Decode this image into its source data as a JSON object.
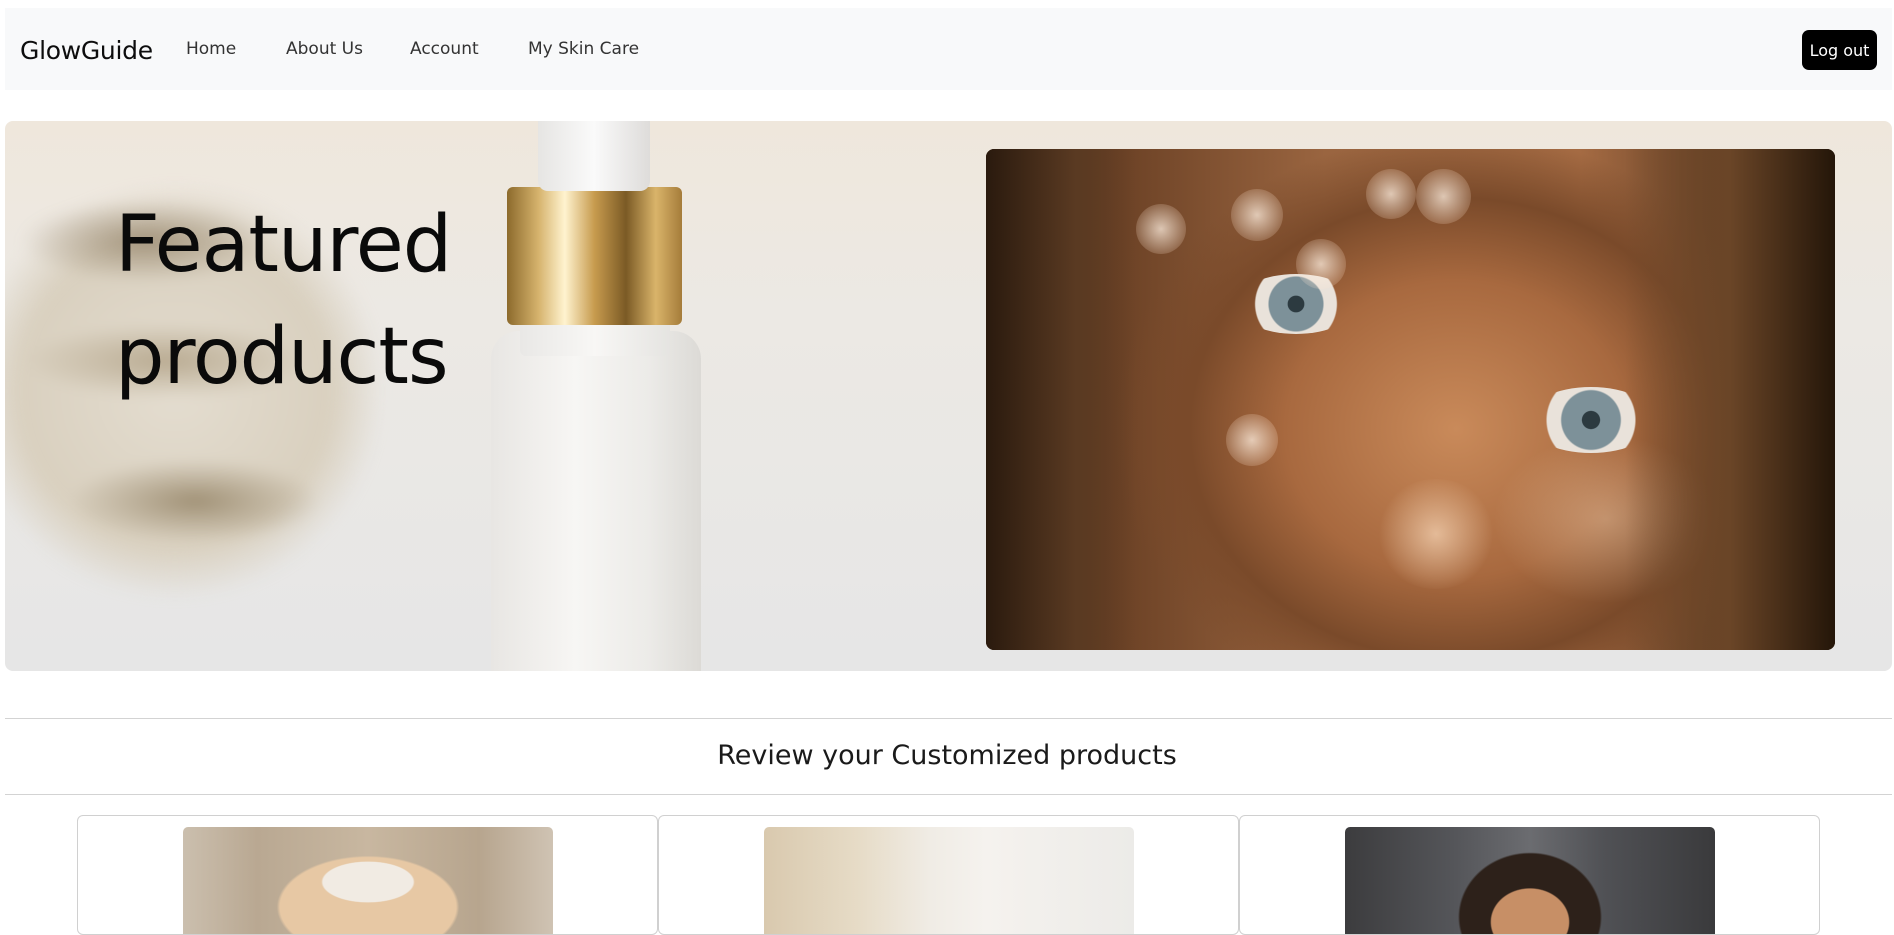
{
  "navbar": {
    "brand": "GlowGuide",
    "links": [
      "Home",
      "About Us",
      "Account",
      "My Skin Care"
    ],
    "logout_label": "Log out"
  },
  "hero": {
    "title_line1": "Featured",
    "title_line2": "products"
  },
  "customized": {
    "title": "Review your Customized products",
    "cards": [
      {
        "image": "woman-headband-photo"
      },
      {
        "image": "bathroom-mirror-photo"
      },
      {
        "image": "man-wet-hair-photo"
      }
    ]
  },
  "colors": {
    "navbar_bg": "#f8f9fa",
    "logout_bg": "#000000",
    "logout_text": "#ffffff",
    "divider": "#d3d3d3"
  }
}
